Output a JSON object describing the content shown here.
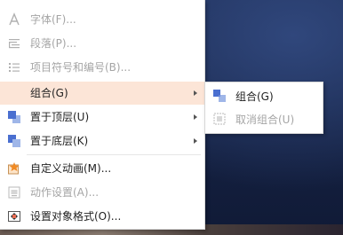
{
  "context_menu": {
    "items": [
      {
        "label": "字体(F)...",
        "icon": "font-a-icon",
        "enabled": false
      },
      {
        "label": "段落(P)...",
        "icon": "paragraph-icon",
        "enabled": false
      },
      {
        "label": "项目符号和编号(B)...",
        "icon": "bullet-list-icon",
        "enabled": false
      },
      {
        "label": "组合(G)",
        "icon": "none",
        "enabled": true,
        "highlighted": true,
        "has_submenu": true
      },
      {
        "label": "置于顶层(U)",
        "icon": "bring-to-front-icon",
        "enabled": true,
        "has_submenu": true
      },
      {
        "label": "置于底层(K)",
        "icon": "send-to-back-icon",
        "enabled": true,
        "has_submenu": true
      },
      {
        "label": "自定义动画(M)...",
        "icon": "custom-animation-icon",
        "enabled": true
      },
      {
        "label": "动作设置(A)...",
        "icon": "action-settings-icon",
        "enabled": false
      },
      {
        "label": "设置对象格式(O)...",
        "icon": "format-object-icon",
        "enabled": true
      }
    ]
  },
  "submenu": {
    "items": [
      {
        "label": "组合(G)",
        "icon": "group-icon",
        "enabled": true
      },
      {
        "label": "取消组合(U)",
        "icon": "ungroup-icon",
        "enabled": false
      }
    ]
  },
  "colors": {
    "highlight": "#fce5d7",
    "disabled_text": "#a5a5a5",
    "icon_blue": "#4a6fd0",
    "icon_orange": "#f08a24"
  }
}
